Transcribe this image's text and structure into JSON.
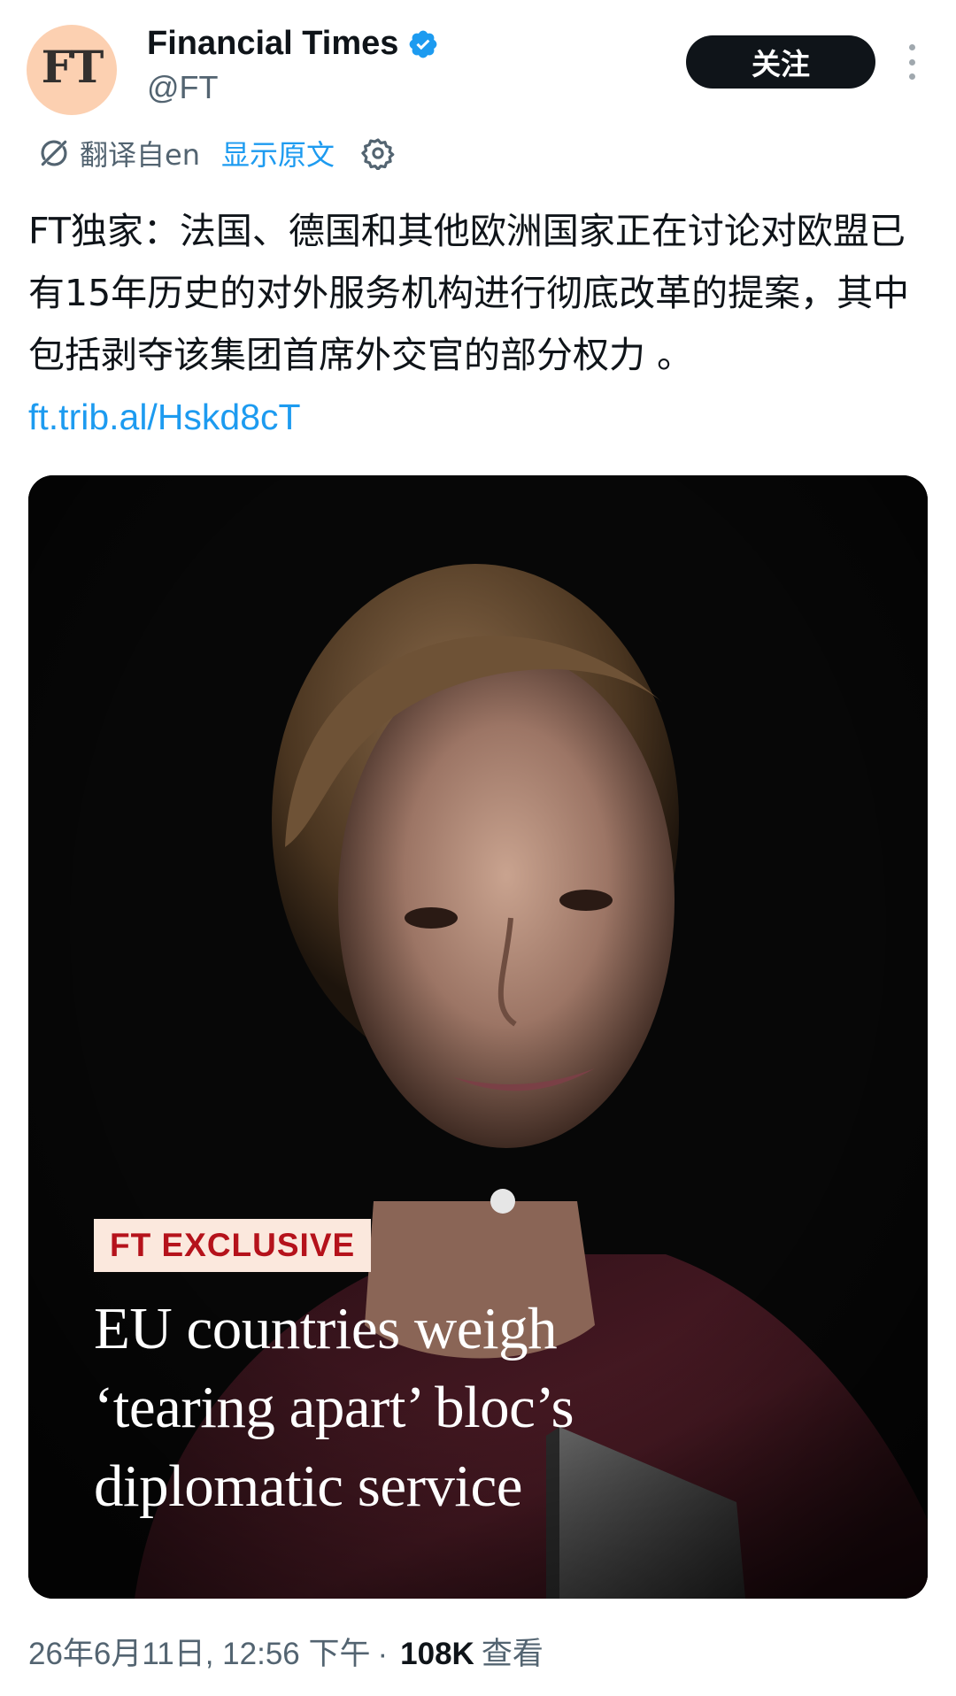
{
  "account": {
    "avatar_text": "FT",
    "display_name": "Financial Times",
    "handle": "@FT",
    "verified": true,
    "avatar_color": "#fcd0b1"
  },
  "follow_button": {
    "label": "关注"
  },
  "translation": {
    "icon": "translate-icon",
    "translated_from": "翻译自en",
    "show_original": "显示原文",
    "settings_icon": "gear-icon"
  },
  "tweet": {
    "text": "FT独家：法国、德国和其他欧洲国家正在讨论对欧盟已有15年历史的对外服务机构进行彻底改革的提案，其中包括剥夺该集团首席外交官的部分权力 。",
    "link": "ft.trib.al/Hskd8cT"
  },
  "media": {
    "badge": "FT EXCLUSIVE",
    "headline_lines": [
      "EU countries weigh",
      "‘tearing apart’ bloc’s",
      "diplomatic service"
    ]
  },
  "meta": {
    "timestamp": "26年6月11日, 12:56 下午",
    "separator": "·",
    "views_count": "108K",
    "views_label": "查看"
  },
  "colors": {
    "link": "#1d9bf0",
    "text_primary": "#0f1419",
    "text_secondary": "#536471",
    "badge_red": "#b5121b",
    "badge_bg": "#fbe8dd"
  }
}
